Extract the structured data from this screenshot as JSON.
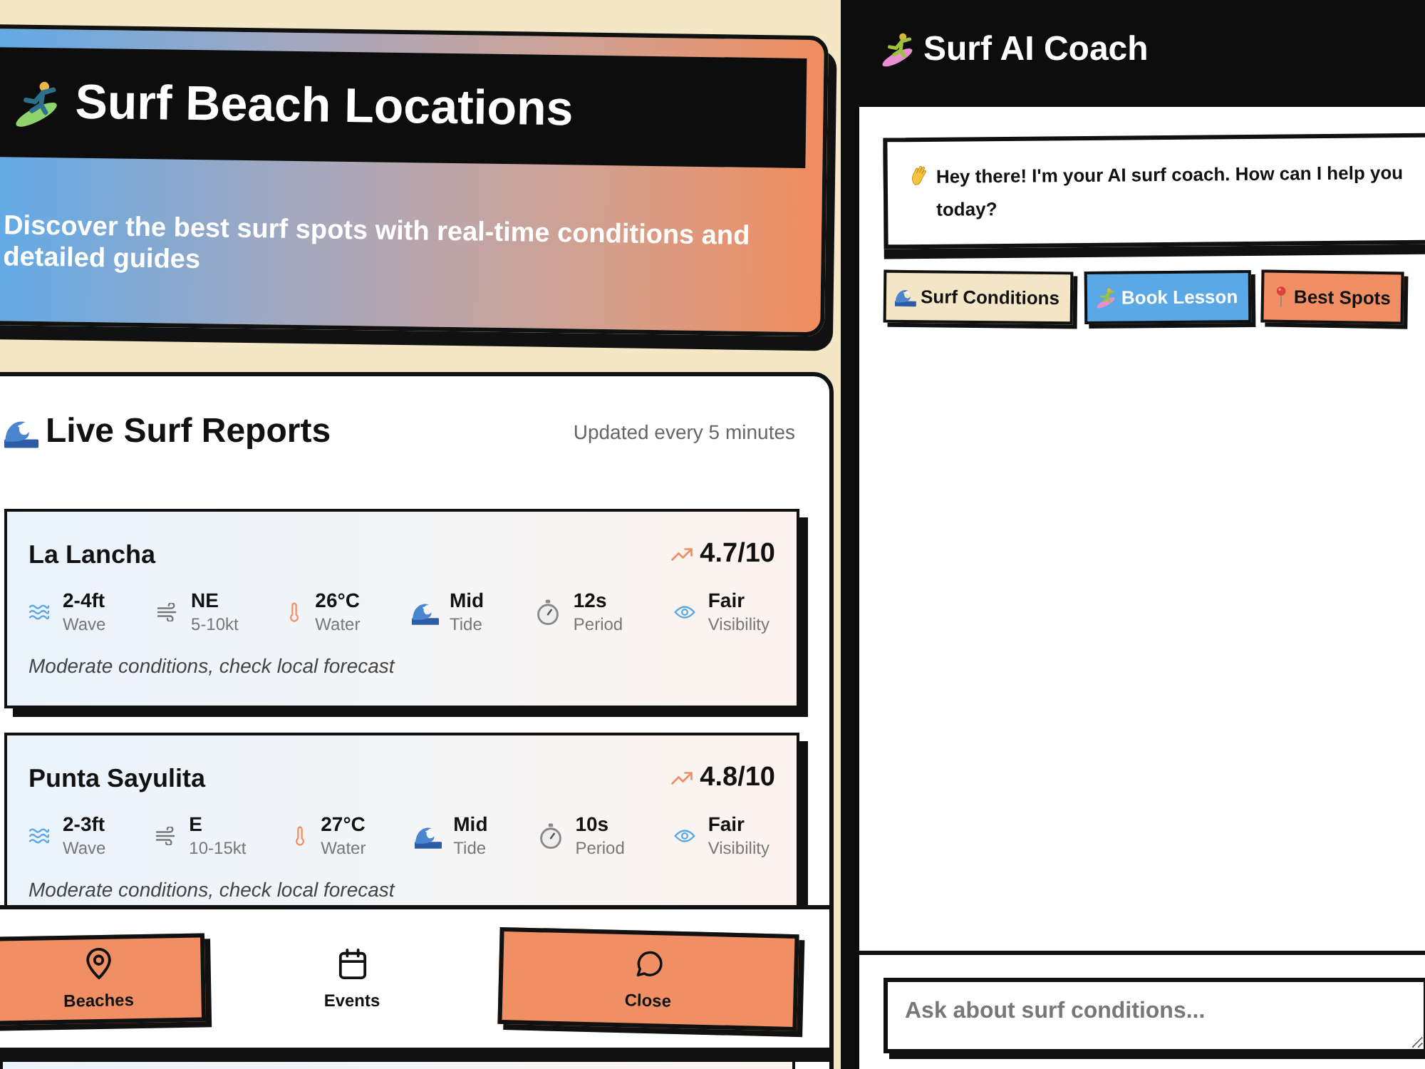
{
  "hero": {
    "title": "Surf Beach Locations",
    "subtitle": "Discover the best surf spots with real-time conditions and detailed guides"
  },
  "reports": {
    "title": "Live Surf Reports",
    "updated": "Updated every 5 minutes",
    "spots": [
      {
        "name": "La Lancha",
        "rating": "4.7/10",
        "stats": [
          {
            "kind": "wave",
            "value": "2-4ft",
            "label": "Wave"
          },
          {
            "kind": "wind",
            "value": "NE",
            "label": "5-10kt"
          },
          {
            "kind": "water",
            "value": "26°C",
            "label": "Water"
          },
          {
            "kind": "tide",
            "value": "Mid",
            "label": "Tide"
          },
          {
            "kind": "period",
            "value": "12s",
            "label": "Period"
          },
          {
            "kind": "visibility",
            "value": "Fair",
            "label": "Visibility"
          }
        ],
        "note": "Moderate conditions, check local forecast"
      },
      {
        "name": "Punta Sayulita",
        "rating": "4.8/10",
        "stats": [
          {
            "kind": "wave",
            "value": "2-3ft",
            "label": "Wave"
          },
          {
            "kind": "wind",
            "value": "E",
            "label": "10-15kt"
          },
          {
            "kind": "water",
            "value": "27°C",
            "label": "Water"
          },
          {
            "kind": "tide",
            "value": "Mid",
            "label": "Tide"
          },
          {
            "kind": "period",
            "value": "10s",
            "label": "Period"
          },
          {
            "kind": "visibility",
            "value": "Fair",
            "label": "Visibility"
          }
        ],
        "note": "Moderate conditions, check local forecast"
      }
    ]
  },
  "bottom_nav": [
    {
      "kind": "pin",
      "label": "Beaches",
      "selected": true
    },
    {
      "kind": "calendar",
      "label": "Events",
      "selected": false
    },
    {
      "kind": "chat",
      "label": "Close",
      "selected": true
    }
  ],
  "coach": {
    "title": "Surf AI Coach",
    "messages": [
      {
        "text": "Hey there! I'm your AI surf coach. How can I help you today?"
      }
    ],
    "quick_replies": [
      {
        "kind": "wave",
        "label": "Surf Conditions",
        "color": "#f3e6c6"
      },
      {
        "kind": "surfer",
        "label": "Book Lesson",
        "color": "#5aa9e6"
      },
      {
        "kind": "pin",
        "label": "Best Spots",
        "color": "#ef8f63"
      }
    ],
    "input": {
      "placeholder": "Ask about surf conditions..."
    }
  }
}
